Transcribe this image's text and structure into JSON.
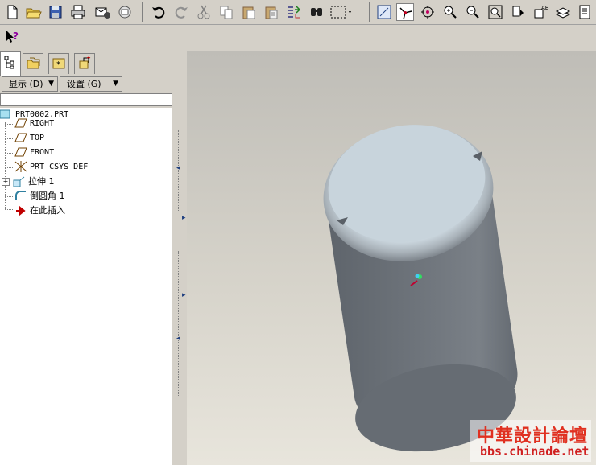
{
  "toolbar": {
    "icons": [
      "new-file-icon",
      "open-folder-icon",
      "save-icon",
      "print-icon",
      "send-mail-icon",
      "print-preview-icon",
      "undo-icon",
      "redo-icon",
      "cut-icon",
      "copy-icon",
      "paste-icon",
      "paste-special-icon",
      "regenerate-icon",
      "find-icon",
      "selection-box-icon",
      "datum-display-icon",
      "spin-center-icon",
      "orient-mode-icon",
      "zoom-in-icon",
      "zoom-out-icon",
      "refit-icon",
      "view-manager-icon",
      "saved-views-icon",
      "layers-icon",
      "model-tree-icon"
    ]
  },
  "toolbar2": {
    "icons": [
      "context-help-icon"
    ]
  },
  "panel": {
    "tabs": [
      "model-tree-tab",
      "folder-browser-tab",
      "favorites-tab",
      "connections-tab"
    ],
    "show_menu_label": "显示 (D)",
    "settings_menu_label": "设置 (G)"
  },
  "tree": {
    "items": [
      {
        "label": "PRT0002.PRT",
        "icon": "part-icon"
      },
      {
        "label": "RIGHT",
        "icon": "datum-plane-icon"
      },
      {
        "label": "TOP",
        "icon": "datum-plane-icon"
      },
      {
        "label": "FRONT",
        "icon": "datum-plane-icon"
      },
      {
        "label": "PRT_CSYS_DEF",
        "icon": "coordinate-system-icon"
      },
      {
        "label": "拉伸 1",
        "icon": "extrude-feature-icon"
      },
      {
        "label": "倒圆角 1",
        "icon": "round-feature-icon"
      },
      {
        "label": "在此插入",
        "icon": "insert-here-arrow-icon"
      }
    ]
  },
  "viewport": {
    "model": "cylinder-with-rounded-top",
    "colors": {
      "body": "#6f757c",
      "top_face": "#c8d4dc",
      "background_top": "#bfbdb7",
      "background_bottom": "#e8e5dc"
    }
  },
  "watermark": {
    "title": "中華設計論壇",
    "url": "bbs.chinade.net"
  }
}
